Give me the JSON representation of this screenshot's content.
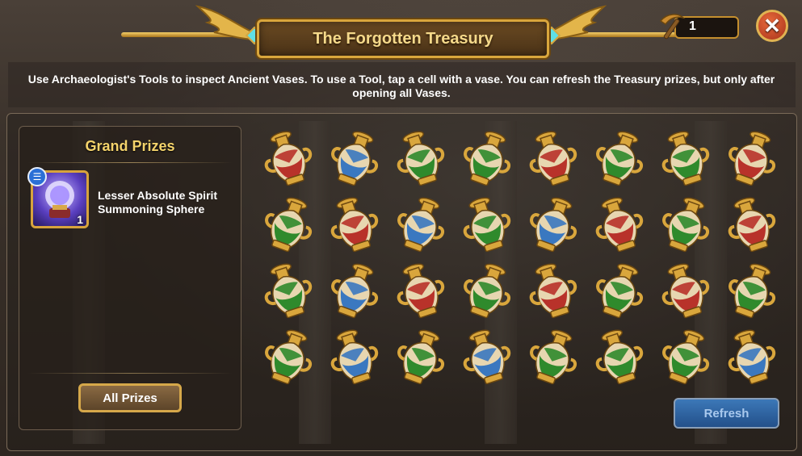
{
  "header": {
    "title": "The Forgotten Treasury",
    "tool_count": "1",
    "close_icon": "close-icon"
  },
  "description": "Use Archaeologist's Tools to inspect Ancient Vases. To use a Tool, tap a cell with a vase. You can refresh the Treasury prizes, but only after opening all Vases.",
  "grand_prizes": {
    "title": "Grand Prizes",
    "items": [
      {
        "name": "Lesser Absolute Spirit Summoning Sphere",
        "quantity": "1",
        "icon": "spirit-sphere-icon"
      }
    ],
    "all_prizes_label": "All Prizes"
  },
  "vases": [
    [
      "red",
      "blue",
      "green",
      "green",
      "red",
      "green",
      "green",
      "red"
    ],
    [
      "green",
      "red",
      "blue",
      "green",
      "blue",
      "red",
      "green",
      "red"
    ],
    [
      "green",
      "blue",
      "red",
      "green",
      "red",
      "green",
      "red",
      "green"
    ],
    [
      "green",
      "blue",
      "green",
      "blue",
      "green",
      "green",
      "green",
      "blue"
    ]
  ],
  "refresh_label": "Refresh",
  "colors": {
    "red": "#b8322a",
    "green": "#2f8a2c",
    "blue": "#3a78c0",
    "gold": "#d9a63c"
  }
}
